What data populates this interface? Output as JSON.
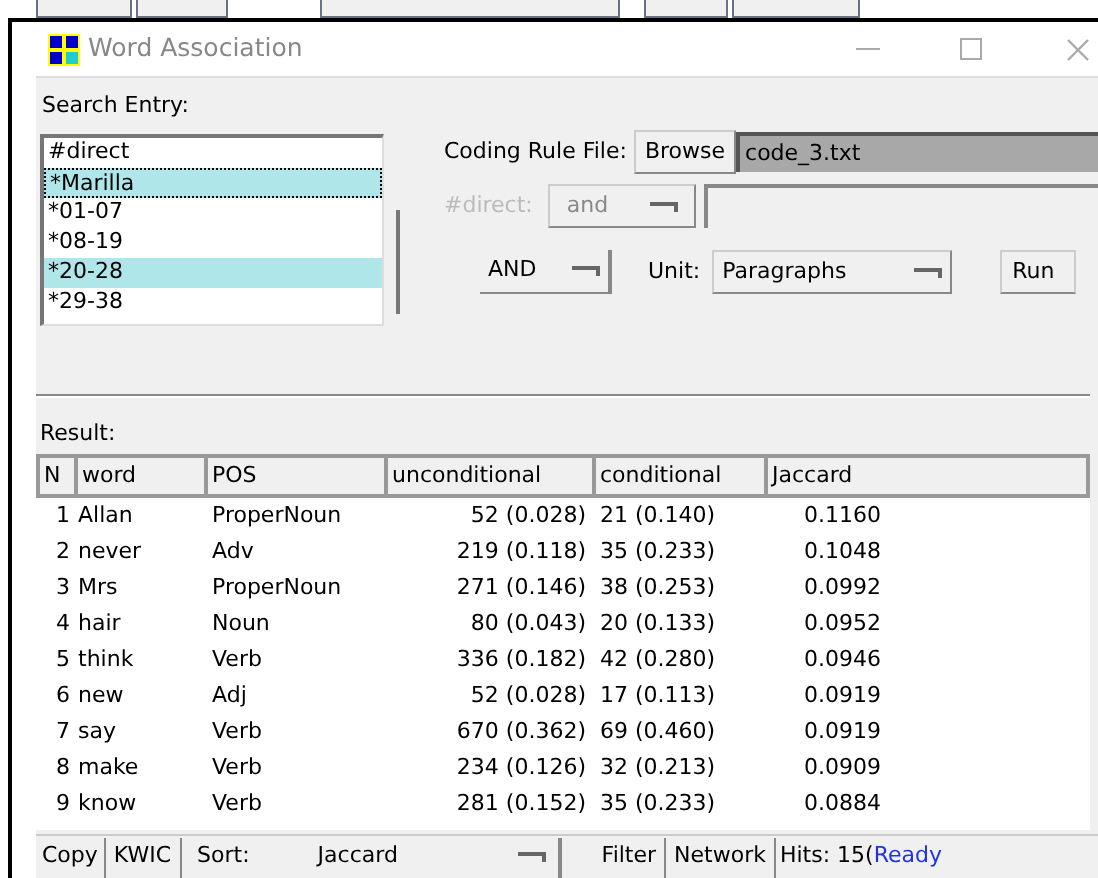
{
  "window": {
    "title": "Word Association"
  },
  "search_entry": {
    "label": "Search Entry:",
    "items": [
      {
        "text": "#direct",
        "selected": false
      },
      {
        "text": "*Marilla",
        "selected": true
      },
      {
        "text": "*01-07",
        "selected": false
      },
      {
        "text": "*08-19",
        "selected": false
      },
      {
        "text": "*20-28",
        "selected": true
      },
      {
        "text": "*29-38",
        "selected": false
      }
    ]
  },
  "coding_rule": {
    "label": "Coding Rule File:",
    "browse": "Browse",
    "file": "code_3.txt",
    "direct_label": "#direct:",
    "direct_op": "and",
    "disabled": true
  },
  "options": {
    "operator": "AND",
    "unit_label": "Unit:",
    "unit": "Paragraphs",
    "run": "Run"
  },
  "result": {
    "label": "Result:",
    "columns": [
      "N",
      "word",
      "POS",
      "unconditional",
      "conditional",
      "Jaccard"
    ],
    "rows": [
      [
        "1",
        "Allan",
        "ProperNoun",
        "52 (0.028)",
        "21 (0.140)",
        "0.1160"
      ],
      [
        "2",
        "never",
        "Adv",
        "219 (0.118)",
        "35 (0.233)",
        "0.1048"
      ],
      [
        "3",
        "Mrs",
        "ProperNoun",
        "271 (0.146)",
        "38 (0.253)",
        "0.0992"
      ],
      [
        "4",
        "hair",
        "Noun",
        "80 (0.043)",
        "20 (0.133)",
        "0.0952"
      ],
      [
        "5",
        "think",
        "Verb",
        "336 (0.182)",
        "42 (0.280)",
        "0.0946"
      ],
      [
        "6",
        "new",
        "Adj",
        "52 (0.028)",
        "17 (0.113)",
        "0.0919"
      ],
      [
        "7",
        "say",
        "Verb",
        "670 (0.362)",
        "69 (0.460)",
        "0.0919"
      ],
      [
        "8",
        "make",
        "Verb",
        "234 (0.126)",
        "32 (0.213)",
        "0.0909"
      ],
      [
        "9",
        "know",
        "Verb",
        "281 (0.152)",
        "35 (0.233)",
        "0.0884"
      ]
    ]
  },
  "bottom_bar": {
    "copy": "Copy",
    "kwic": "KWIC",
    "sort_label": "Sort:",
    "sort": "Jaccard",
    "filter": "Filter",
    "network": "Network",
    "hits": "Hits: 15(",
    "status": "Ready"
  }
}
